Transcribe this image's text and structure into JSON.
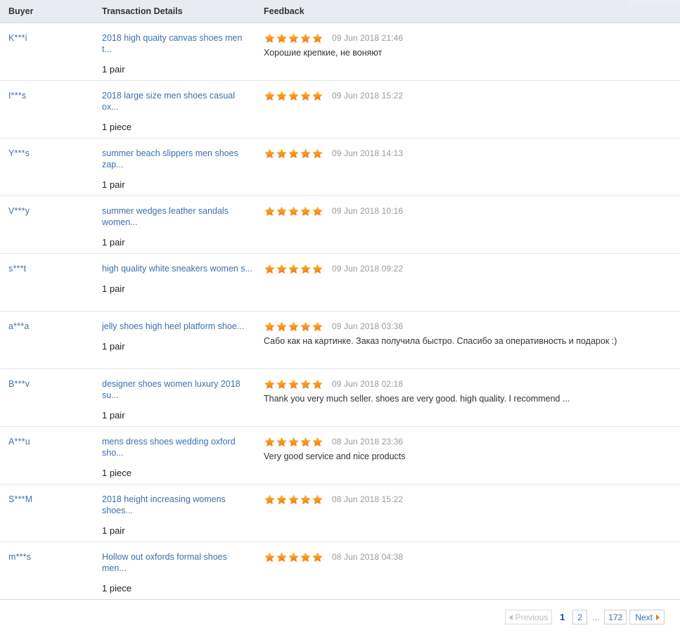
{
  "table": {
    "columns": [
      {
        "key": "buyer",
        "label": "Buyer"
      },
      {
        "key": "details",
        "label": "Transaction Details"
      },
      {
        "key": "feedback",
        "label": "Feedback"
      }
    ],
    "rows": [
      {
        "buyer": "K***i",
        "product": "2018 high quaity canvas shoes men t...",
        "quantity": "1 pair",
        "rating": 5,
        "date": "09 Jun 2018 21:46",
        "comment": "Хорошие крепкие, не воняют"
      },
      {
        "buyer": "I***s",
        "product": "2018 large size men shoes casual ox...",
        "quantity": "1 piece",
        "rating": 5,
        "date": "09 Jun 2018 15:22",
        "comment": ""
      },
      {
        "buyer": "Y***s",
        "product": "summer beach slippers men shoes zap...",
        "quantity": "1 pair",
        "rating": 5,
        "date": "09 Jun 2018 14:13",
        "comment": ""
      },
      {
        "buyer": "V***y",
        "product": "summer wedges leather sandals women...",
        "quantity": "1 pair",
        "rating": 5,
        "date": "09 Jun 2018 10:16",
        "comment": ""
      },
      {
        "buyer": "s***t",
        "product": "high quality white sneakers women s...",
        "quantity": "1 pair",
        "rating": 5,
        "date": "09 Jun 2018 09:22",
        "comment": ""
      },
      {
        "buyer": "a***a",
        "product": "jelly shoes high heel platform shoe...",
        "quantity": "1 pair",
        "rating": 5,
        "date": "09 Jun 2018 03:36",
        "comment": "Сабо как на картинке. Заказ получила быстро. Спасибо за оперативность и подарок :)"
      },
      {
        "buyer": "B***v",
        "product": "designer shoes women luxury 2018 su...",
        "quantity": "1 pair",
        "rating": 5,
        "date": "09 Jun 2018 02:18",
        "comment": "Thank you very much seller. shoes are very good. high quality. I recommend ..."
      },
      {
        "buyer": "A***u",
        "product": "mens dress shoes wedding oxford sho...",
        "quantity": "1 piece",
        "rating": 5,
        "date": "08 Jun 2018 23:36",
        "comment": "Very good service and nice products"
      },
      {
        "buyer": "S***M",
        "product": "2018 height increasing womens shoes...",
        "quantity": "1 pair",
        "rating": 5,
        "date": "08 Jun 2018 15:22",
        "comment": ""
      },
      {
        "buyer": "m***s",
        "product": "Hollow out oxfords formal shoes men...",
        "quantity": "1 piece",
        "rating": 5,
        "date": "08 Jun 2018 04:38",
        "comment": ""
      }
    ]
  },
  "pagination": {
    "previous_label": "Previous",
    "next_label": "Next",
    "ellipsis": "...",
    "current_page": "1",
    "pages": [
      "2",
      "172"
    ],
    "previous_enabled": false
  },
  "colors": {
    "header_bg": "#e9ebf2",
    "link": "#3d6fb0",
    "star": "#f7941e",
    "date_text": "#9a9a9a",
    "current_page": "#22489c"
  }
}
